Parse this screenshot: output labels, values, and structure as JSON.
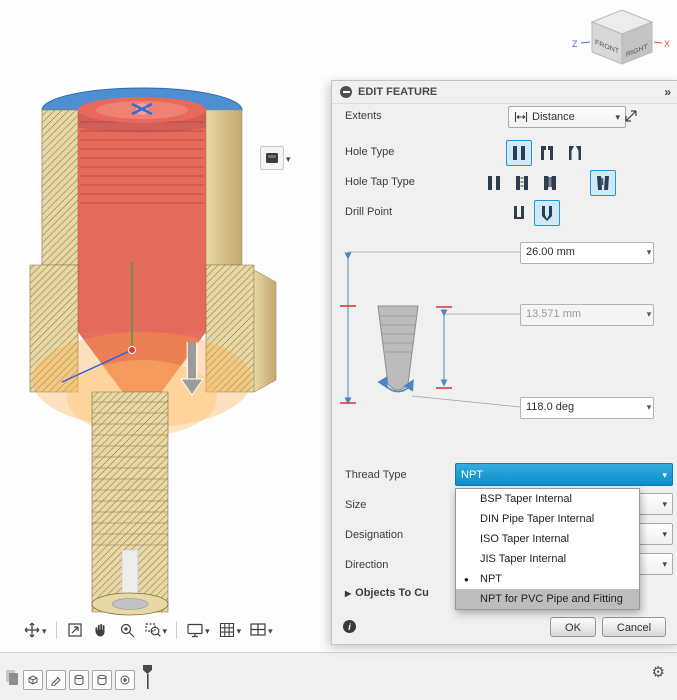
{
  "viewcube": {
    "front_label": "FRONT",
    "right_label": "RIGHT",
    "z_axis_label": "Z",
    "x_axis_label": "X"
  },
  "dialog": {
    "title": "EDIT FEATURE",
    "extents_label": "Extents",
    "extents_value": "Distance",
    "hole_type_label": "Hole Type",
    "hole_tap_type_label": "Hole Tap Type",
    "drill_point_label": "Drill Point",
    "depth_value": "26.00 mm",
    "tap_drill_diameter_value": "13.571 mm",
    "point_angle_value": "118.0 deg",
    "thread_type_label": "Thread Type",
    "thread_type_value": "NPT",
    "size_label": "Size",
    "designation_label": "Designation",
    "direction_label": "Direction",
    "objects_to_cut_label": "Objects To Cu",
    "ok_label": "OK",
    "cancel_label": "Cancel"
  },
  "thread_type_menu": {
    "items": [
      {
        "label": "BSP Taper Internal"
      },
      {
        "label": "DIN Pipe Taper Internal"
      },
      {
        "label": "ISO Taper Internal"
      },
      {
        "label": "JIS Taper Internal"
      },
      {
        "label": "NPT"
      },
      {
        "label": "NPT for PVC Pipe and Fitting"
      }
    ],
    "selected_item": "NPT",
    "highlighted_item": "NPT for PVC Pipe and Fitting"
  },
  "colors": {
    "accent": "#0696d7",
    "selected_button_bg": "#cfe9f8",
    "menu_highlight_bg": "#bdbdbd",
    "hole_preview_red": "#e05a4b",
    "section_tan": "#e7d9a7",
    "glow_orange": "#ffa43c"
  }
}
